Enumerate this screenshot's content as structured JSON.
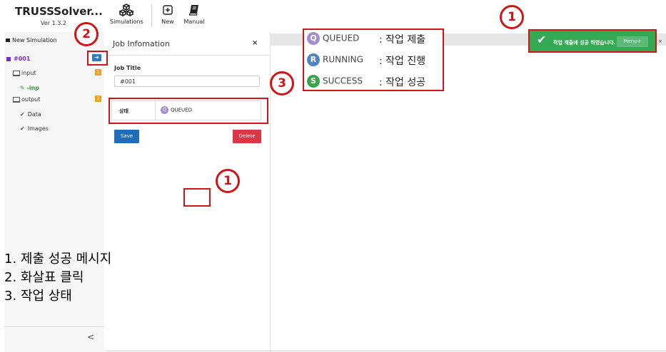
{
  "app": {
    "title": "TRUSSSolver...",
    "version": "Ver 1.3.2"
  },
  "toolbar": {
    "simulations": "Simulations",
    "new": "New",
    "manual": "Manual"
  },
  "sidebar": {
    "new_simulation": "New Simulation",
    "job": "#001",
    "input": "input",
    "input_badge": "1",
    "inp_file": "-inp",
    "output": "output",
    "output_badge": "2",
    "data": "Data",
    "images": "Images",
    "arrow": "➔",
    "collapse": "<"
  },
  "job_panel": {
    "title": "Job Infomation",
    "close": "×",
    "job_title_label": "Job Title",
    "job_title_value": "#001",
    "status_label": "상태",
    "status_value": "QUEUED",
    "status_letter": "Q",
    "save": "Save",
    "delete": "Delete"
  },
  "legend": [
    {
      "letter": "Q",
      "name": "QUEUED",
      "desc": "  : 작업 제출",
      "color": "#a58bd0"
    },
    {
      "letter": "R",
      "name": "RUNNING",
      "desc": "  : 작업 진행",
      "color": "#4f84c4"
    },
    {
      "letter": "S",
      "name": "SUCCESS",
      "desc": "  : 작업 성공",
      "color": "#3aa54a"
    }
  ],
  "toast": {
    "message": "작업 제출에 성공 하였습니다.",
    "ghost": "Menu+",
    "close": "×"
  },
  "annotations": {
    "n1": "1",
    "n2": "2",
    "n3": "3",
    "n1b": "1"
  },
  "notes": [
    "1. 제출 성공 메시지",
    "2. 화살표 클릭",
    "3. 작업 상태"
  ]
}
